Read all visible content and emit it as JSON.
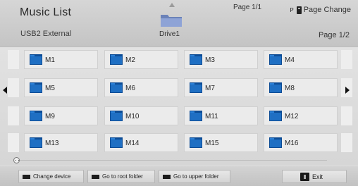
{
  "header": {
    "title": "Music List",
    "device_name": "USB2 External",
    "page_indicator_top": "Page 1/1",
    "page_change_label": "Page Change",
    "page_change_badge": "P",
    "page_indicator_bottom": "Page 1/2",
    "drive_label": "Drive1"
  },
  "folders": [
    {
      "name": "M1"
    },
    {
      "name": "M2"
    },
    {
      "name": "M3"
    },
    {
      "name": "M4"
    },
    {
      "name": "M5"
    },
    {
      "name": "M6"
    },
    {
      "name": "M7"
    },
    {
      "name": "M8"
    },
    {
      "name": "M9"
    },
    {
      "name": "M10"
    },
    {
      "name": "M11"
    },
    {
      "name": "M12"
    },
    {
      "name": "M13"
    },
    {
      "name": "M14"
    },
    {
      "name": "M15"
    },
    {
      "name": "M16"
    }
  ],
  "footer": {
    "change_device": "Change device",
    "root_folder": "Go to root folder",
    "upper_folder": "Go to upper folder",
    "exit": "Exit"
  },
  "icons": {
    "folder": "folder-icon",
    "drive": "drive-folder-icon",
    "up": "up-arrow-icon",
    "left": "left-arrow-icon",
    "right": "right-arrow-icon",
    "scroll": "scroll-knob-icon",
    "exit": "exit-icon"
  },
  "colors": {
    "folder_blue": "#1f6fc3",
    "folder_blue_dark": "#0d4c95",
    "background": "#e2e2e2"
  }
}
